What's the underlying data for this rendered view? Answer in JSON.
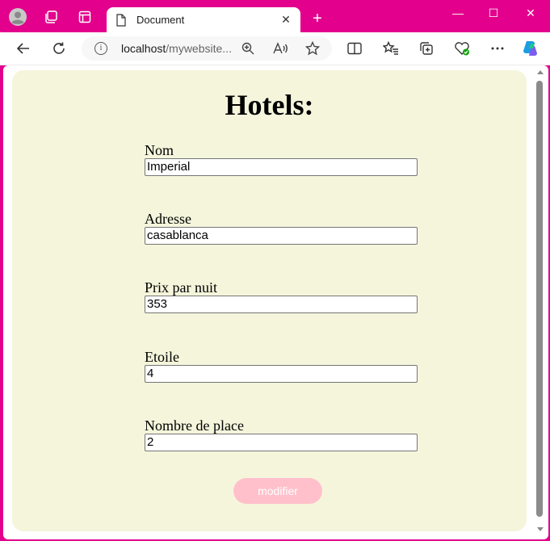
{
  "browser": {
    "tab_title": "Document",
    "tab_close": "✕",
    "new_tab": "+",
    "url_host": "localhost",
    "url_path": "/mywebsite...",
    "minimize": "—",
    "maximize": "☐",
    "close": "✕"
  },
  "page": {
    "heading": "Hotels:",
    "fields": [
      {
        "label": "Nom",
        "value": "Imperial"
      },
      {
        "label": "Adresse",
        "value": "casablanca"
      },
      {
        "label": "Prix par nuit",
        "value": "353"
      },
      {
        "label": "Etoile",
        "value": "4"
      },
      {
        "label": "Nombre de place",
        "value": "2"
      }
    ],
    "submit_label": "modifier"
  },
  "colors": {
    "frame": "#e3008c",
    "page_background": "#f5f5dc",
    "button_background": "#ffc0cb"
  }
}
